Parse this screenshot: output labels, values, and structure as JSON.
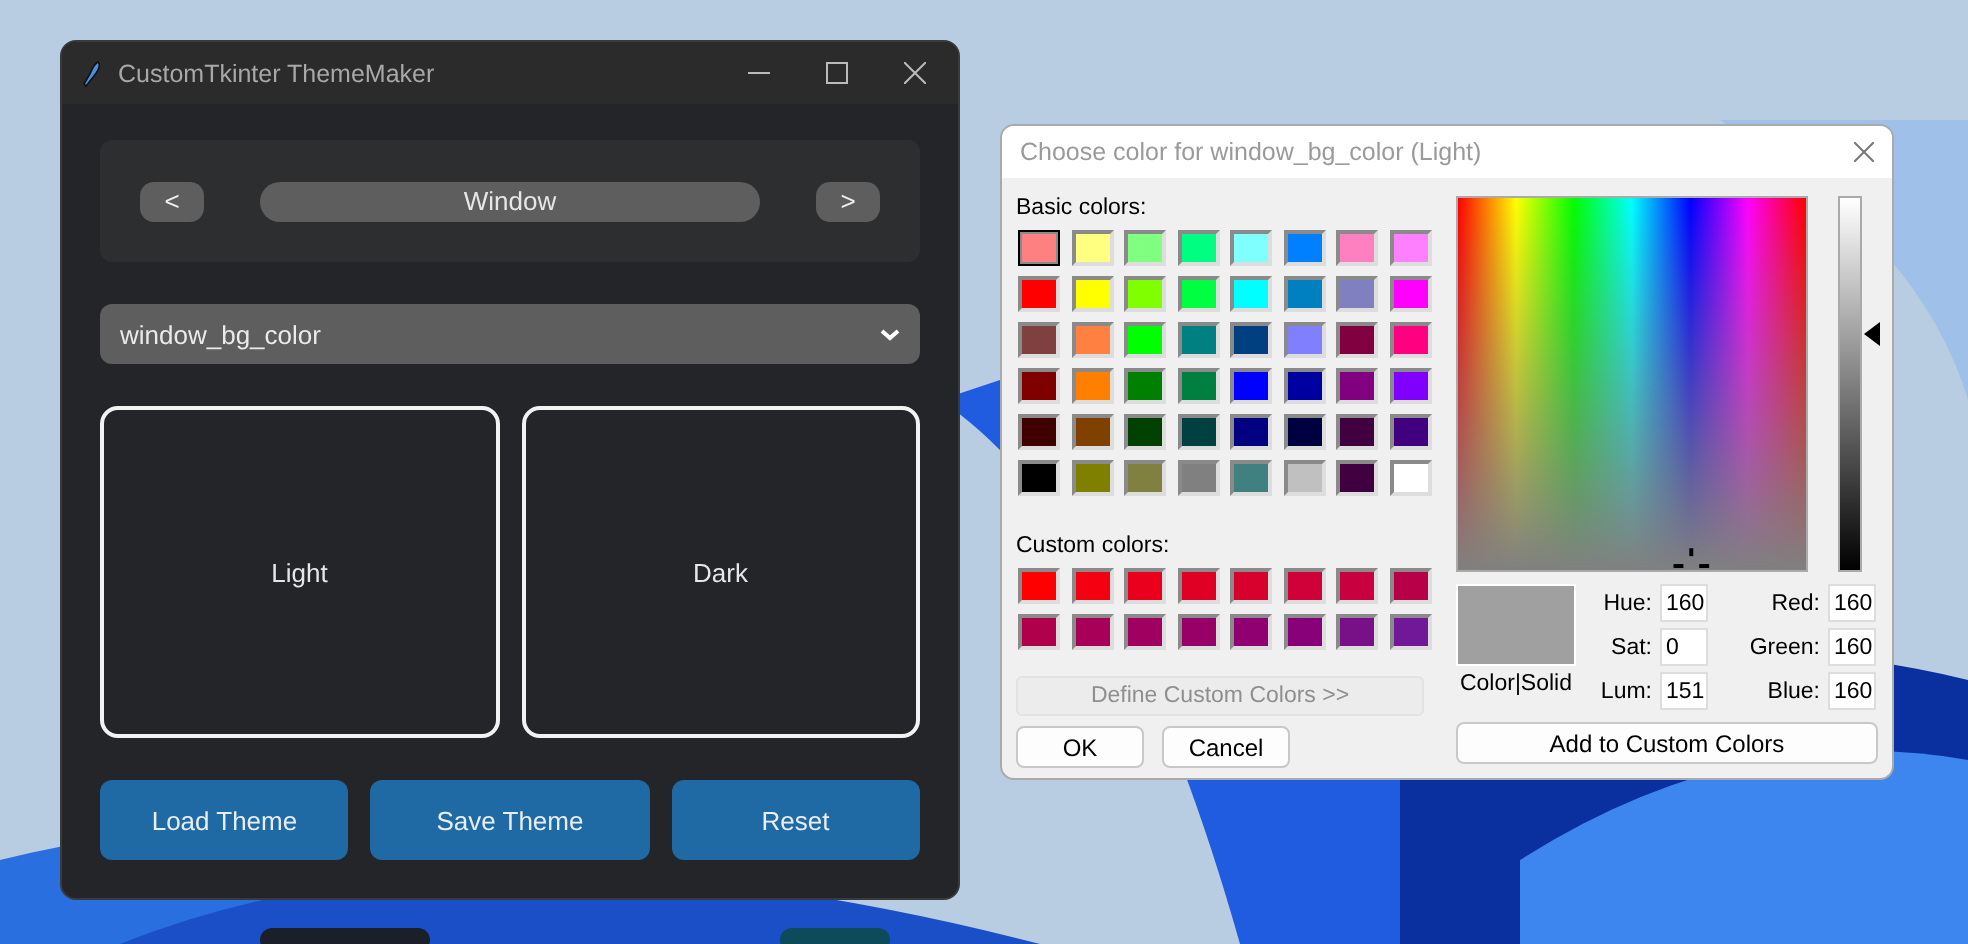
{
  "app_window": {
    "title": "CustomTkinter ThemeMaker",
    "nav": {
      "prev": "<",
      "label": "Window",
      "next": ">"
    },
    "dropdown": {
      "value": "window_bg_color"
    },
    "previews": [
      {
        "label": "Light"
      },
      {
        "label": "Dark"
      }
    ],
    "buttons": [
      "Load Theme",
      "Save Theme",
      "Reset"
    ]
  },
  "color_dialog": {
    "title": "Choose color for window_bg_color (Light)",
    "basic_label": "Basic colors:",
    "basic_colors": [
      {
        "color": "#ff8080",
        "selected": true
      },
      {
        "color": "#ffff80",
        "selected": false
      },
      {
        "color": "#80ff80",
        "selected": false
      },
      {
        "color": "#00ff80",
        "selected": false
      },
      {
        "color": "#80ffff",
        "selected": false
      },
      {
        "color": "#0080ff",
        "selected": false
      },
      {
        "color": "#ff80c0",
        "selected": false
      },
      {
        "color": "#ff80ff",
        "selected": false
      },
      {
        "color": "#ff0000",
        "selected": false
      },
      {
        "color": "#ffff00",
        "selected": false
      },
      {
        "color": "#80ff00",
        "selected": false
      },
      {
        "color": "#00ff40",
        "selected": false
      },
      {
        "color": "#00ffff",
        "selected": false
      },
      {
        "color": "#0080c0",
        "selected": false
      },
      {
        "color": "#8080c0",
        "selected": false
      },
      {
        "color": "#ff00ff",
        "selected": false
      },
      {
        "color": "#804040",
        "selected": false
      },
      {
        "color": "#ff8040",
        "selected": false
      },
      {
        "color": "#00ff00",
        "selected": false
      },
      {
        "color": "#008080",
        "selected": false
      },
      {
        "color": "#004080",
        "selected": false
      },
      {
        "color": "#8080ff",
        "selected": false
      },
      {
        "color": "#800040",
        "selected": false
      },
      {
        "color": "#ff0080",
        "selected": false
      },
      {
        "color": "#800000",
        "selected": false
      },
      {
        "color": "#ff8000",
        "selected": false
      },
      {
        "color": "#008000",
        "selected": false
      },
      {
        "color": "#008040",
        "selected": false
      },
      {
        "color": "#0000ff",
        "selected": false
      },
      {
        "color": "#0000a0",
        "selected": false
      },
      {
        "color": "#800080",
        "selected": false
      },
      {
        "color": "#8000ff",
        "selected": false
      },
      {
        "color": "#400000",
        "selected": false
      },
      {
        "color": "#804000",
        "selected": false
      },
      {
        "color": "#004000",
        "selected": false
      },
      {
        "color": "#004040",
        "selected": false
      },
      {
        "color": "#000080",
        "selected": false
      },
      {
        "color": "#000040",
        "selected": false
      },
      {
        "color": "#400040",
        "selected": false
      },
      {
        "color": "#400080",
        "selected": false
      },
      {
        "color": "#000000",
        "selected": false
      },
      {
        "color": "#808000",
        "selected": false
      },
      {
        "color": "#808040",
        "selected": false
      },
      {
        "color": "#808080",
        "selected": false
      },
      {
        "color": "#408080",
        "selected": false
      },
      {
        "color": "#c0c0c0",
        "selected": false
      },
      {
        "color": "#400040",
        "selected": false
      },
      {
        "color": "#ffffff",
        "selected": false
      }
    ],
    "custom_label": "Custom colors:",
    "custom_colors": [
      {
        "color": "#ff0000"
      },
      {
        "color": "#f50010"
      },
      {
        "color": "#ea001c"
      },
      {
        "color": "#e00024"
      },
      {
        "color": "#d8002c"
      },
      {
        "color": "#d00038"
      },
      {
        "color": "#c80040"
      },
      {
        "color": "#b80048"
      },
      {
        "color": "#b0004c"
      },
      {
        "color": "#a80058"
      },
      {
        "color": "#a00060"
      },
      {
        "color": "#980068"
      },
      {
        "color": "#900070"
      },
      {
        "color": "#880078"
      },
      {
        "color": "#781088"
      },
      {
        "color": "#701898"
      }
    ],
    "define_button": {
      "label": "Define Custom Colors >>",
      "disabled": true
    },
    "ok": "OK",
    "cancel": "Cancel",
    "solid_label": "Color|Solid",
    "fields": [
      {
        "label": "Hue:",
        "value": "160"
      },
      {
        "label": "Red:",
        "value": "160"
      },
      {
        "label": "Sat:",
        "value": "0"
      },
      {
        "label": "Green:",
        "value": "160"
      },
      {
        "label": "Lum:",
        "value": "151"
      },
      {
        "label": "Blue:",
        "value": "160"
      }
    ],
    "add_button": "Add to Custom Colors"
  }
}
